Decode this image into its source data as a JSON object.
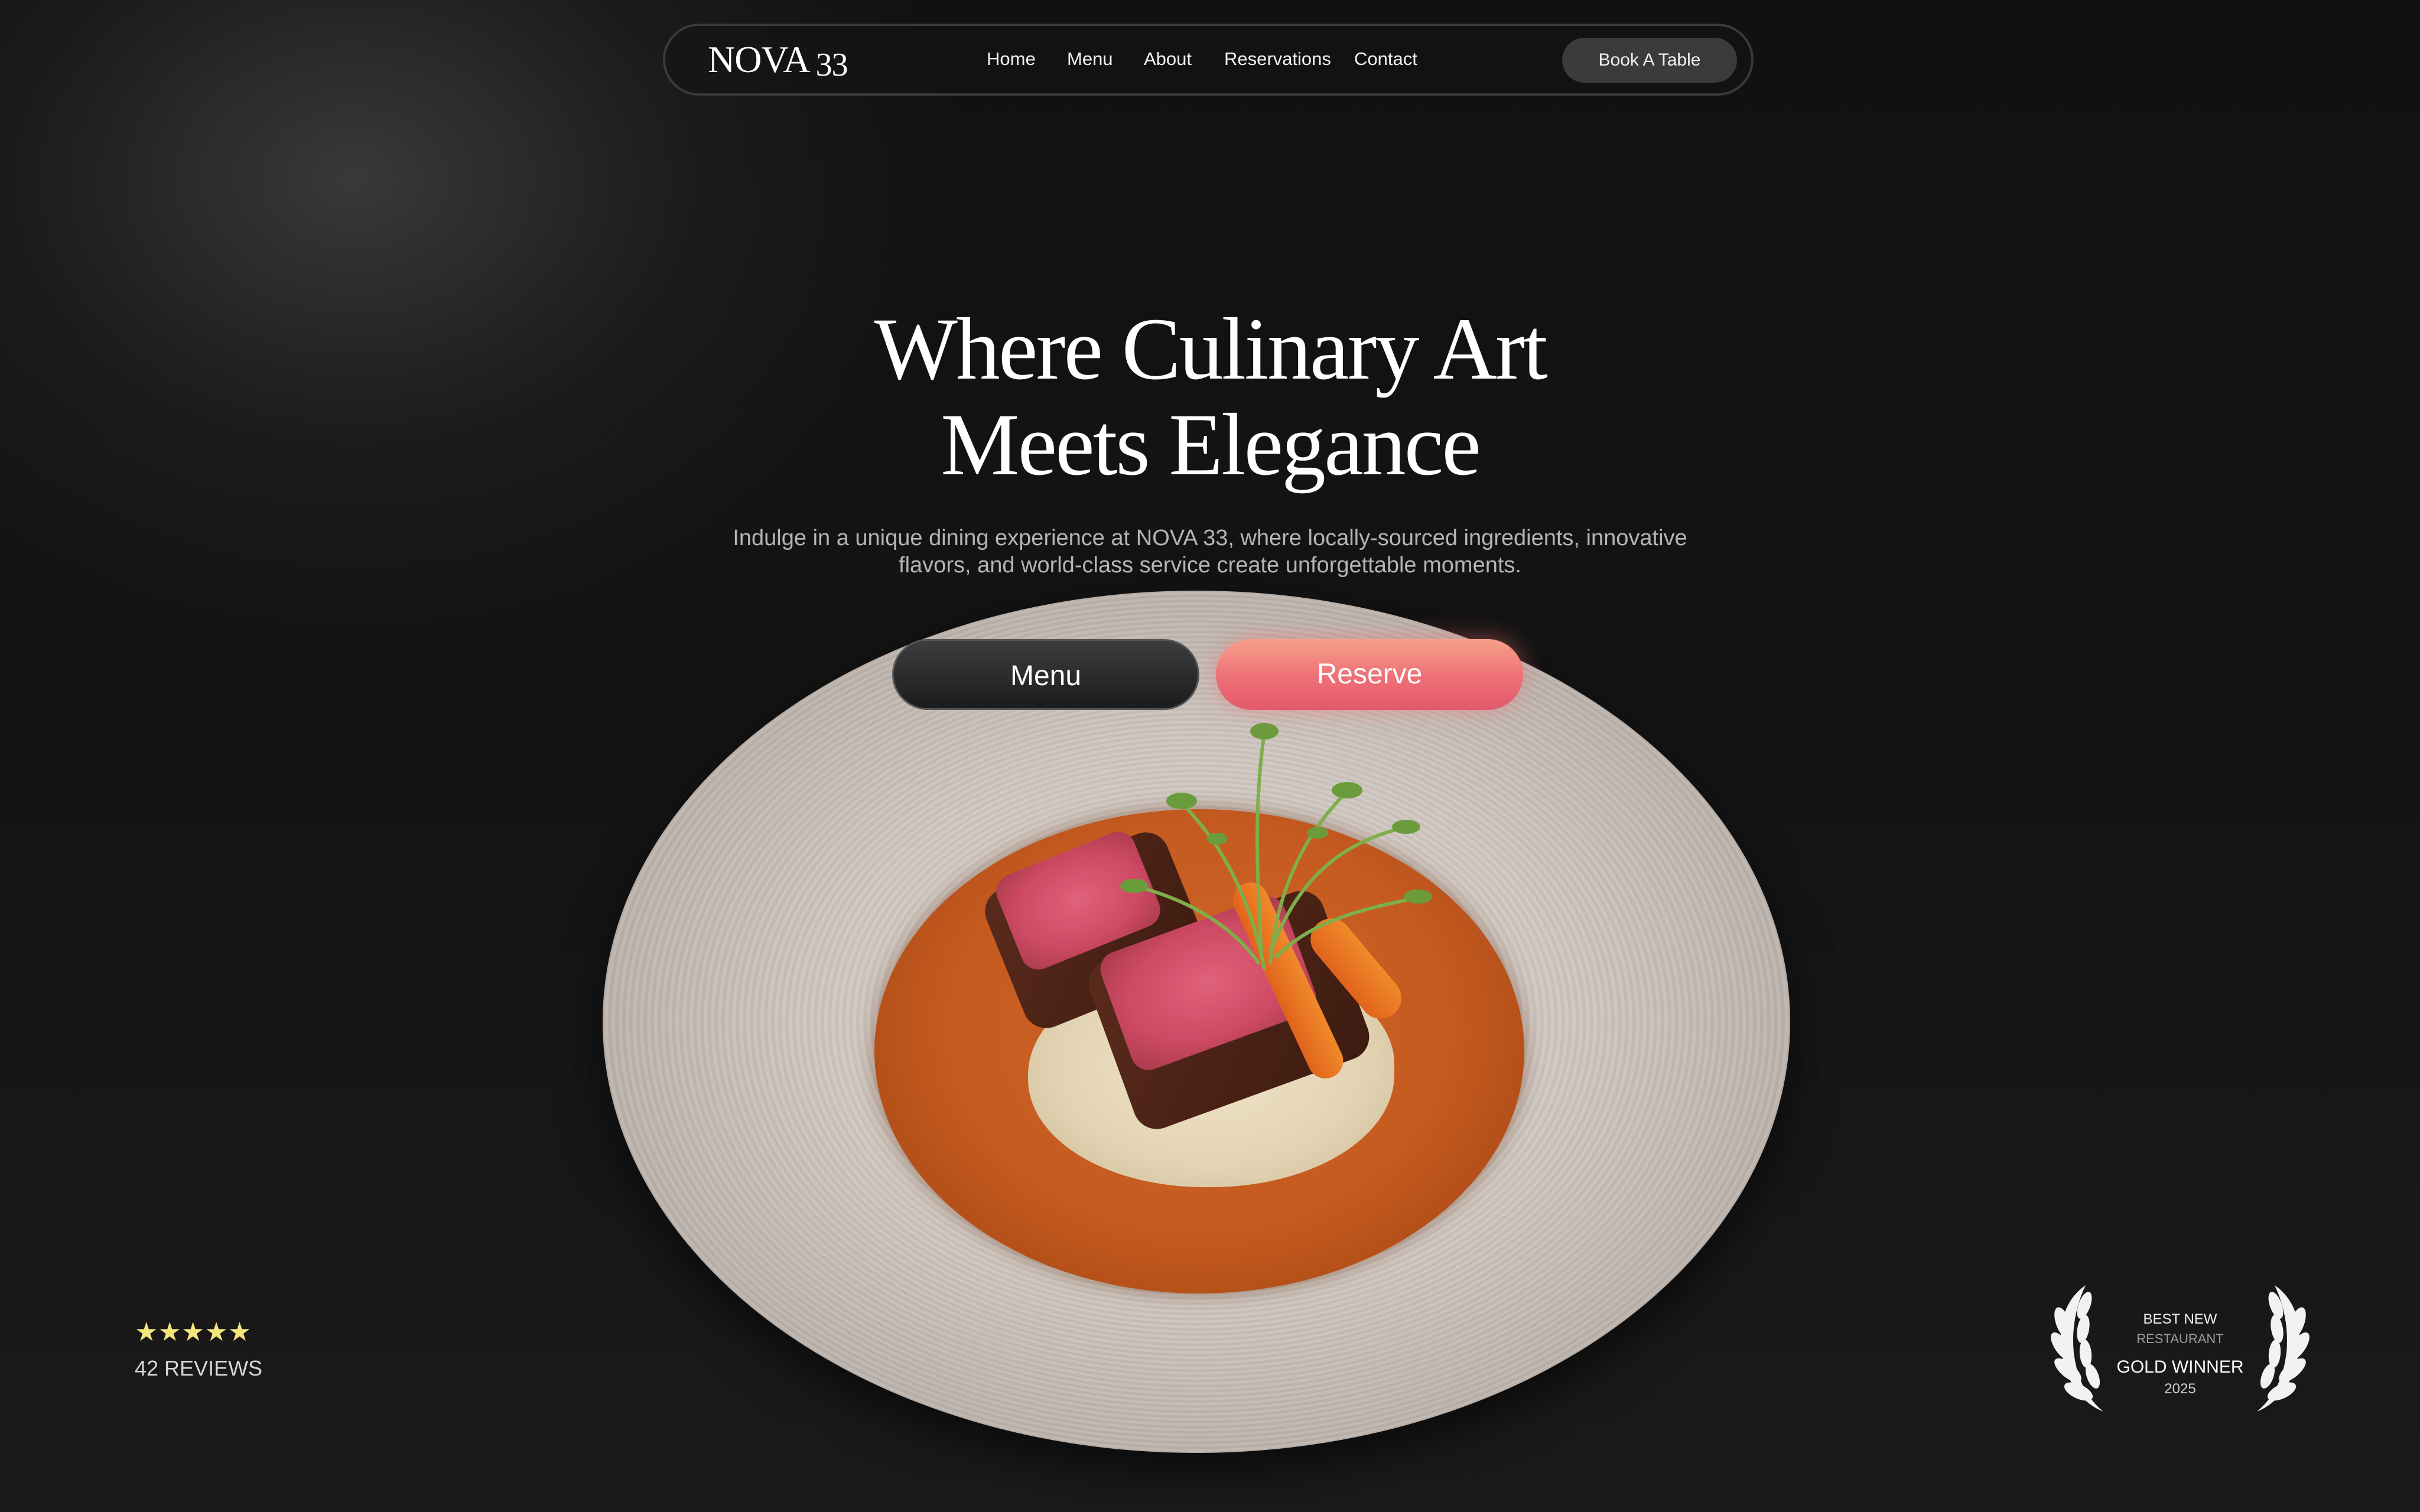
{
  "nav": {
    "logo": "NOVA",
    "logo_number": "33",
    "links": [
      "Home",
      "Menu",
      "About",
      "Reservations",
      "Contact"
    ],
    "cta": "Book A Table"
  },
  "hero": {
    "title_line1": "Where Culinary Art",
    "title_line2": "Meets Elegance",
    "subtitle_line1": "Indulge in a unique dining experience at NOVA 33, where locally-sourced ingredients, innovative",
    "subtitle_line2": "flavors, and world-class service create unforgettable moments.",
    "buttons": {
      "menu": "Menu",
      "reserve": "Reserve"
    }
  },
  "reviews": {
    "stars": "★★★★★",
    "rating": 5,
    "count_label": "42 REVIEWS"
  },
  "award": {
    "line1": "BEST NEW",
    "line2": "RESTAURANT",
    "line3": "GOLD WINNER",
    "line4": "2025"
  },
  "colors": {
    "background": "#161616",
    "reserve_accent": "#ee6f76",
    "star": "#f3e67a"
  }
}
